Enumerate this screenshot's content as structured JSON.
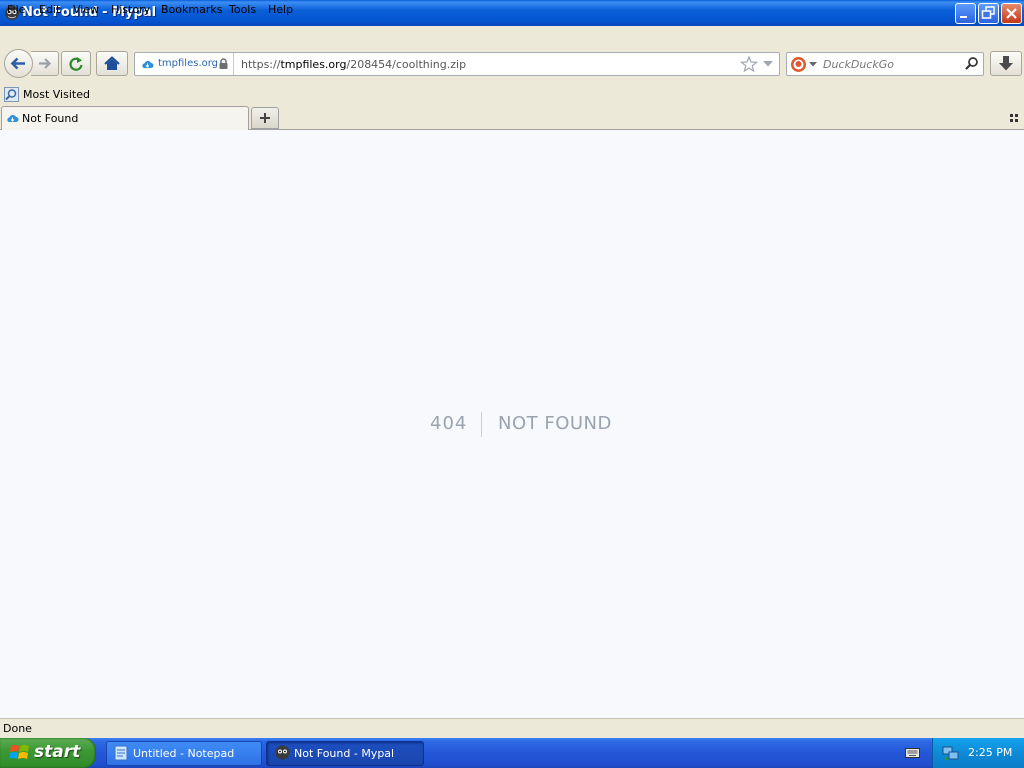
{
  "window": {
    "title": "Not Found - Mypal"
  },
  "menu": {
    "items": [
      "File",
      "Edit",
      "View",
      "History",
      "Bookmarks",
      "Tools",
      "Help"
    ]
  },
  "navbar": {
    "identity_host": "tmpfiles.org",
    "url_prefix": "https://",
    "url_host": "tmpfiles.org",
    "url_path": "/208454/coolthing.zip",
    "search_placeholder": "DuckDuckGo"
  },
  "bookmarks": {
    "items": [
      "Most Visited"
    ]
  },
  "tabs": [
    {
      "label": "Not Found",
      "active": true
    }
  ],
  "page": {
    "error_code": "404",
    "error_message": "NOT FOUND"
  },
  "statusbar": {
    "text": "Done"
  },
  "taskbar": {
    "start_label": "start",
    "tasks": [
      {
        "label": "Untitled - Notepad",
        "active": false
      },
      {
        "label": "Not Found - Mypal",
        "active": true
      }
    ],
    "clock": "2:25 PM"
  },
  "colors": {
    "titlebar": "#0a5fd8",
    "taskbar": "#2457d7",
    "start_button": "#3e9a35",
    "tray": "#0e8ad6",
    "page_background": "#f7f9fc",
    "error_text": "#9aa3ae"
  }
}
